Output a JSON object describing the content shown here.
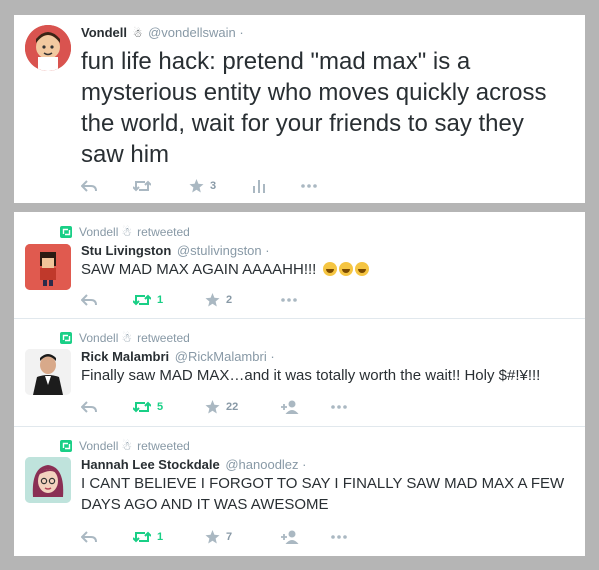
{
  "main_tweet": {
    "fullname": "Vondell",
    "verified": "☃",
    "handle": "@vondellswain",
    "dot": "·",
    "text": "fun life hack: pretend \"mad max\" is a mysterious entity who moves quickly across the world, wait for your friends to say they saw him",
    "favorites": "3",
    "icons": [
      "reply-icon",
      "retweet-icon",
      "star-icon",
      "stats-icon",
      "more-icon"
    ]
  },
  "retweets": [
    {
      "retweeter": "Vondell",
      "retweeter_mark": "☃",
      "retweeted_label": "retweeted",
      "fullname": "Stu Livingston",
      "handle": "@stulivingston",
      "dot": "·",
      "text": "SAW MAD MAX AGAIN AAAAHH!!!",
      "emoji_count": 3,
      "retweets": "1",
      "favorites": "2"
    },
    {
      "retweeter": "Vondell",
      "retweeter_mark": "☃",
      "retweeted_label": "retweeted",
      "fullname": "Rick Malambri",
      "handle": "@RickMalambri",
      "dot": "·",
      "text": "Finally saw MAD MAX…and it was totally worth the wait!! Holy $#!¥!!!",
      "retweets": "5",
      "favorites": "22"
    },
    {
      "retweeter": "Vondell",
      "retweeter_mark": "☃",
      "retweeted_label": "retweeted",
      "fullname": "Hannah Lee Stockdale",
      "handle": "@hanoodlez",
      "dot": "·",
      "text": "I CANT BELIEVE I FORGOT TO SAY I FINALLY SAW MAD MAX A FEW DAYS AGO AND IT WAS AWESOME",
      "retweets": "1",
      "favorites": "7"
    }
  ],
  "colors": {
    "background": "#b5b5b5",
    "retweet_green": "#19cf86",
    "muted": "#8899a6",
    "icon": "#aab8c2",
    "text": "#292f33"
  }
}
